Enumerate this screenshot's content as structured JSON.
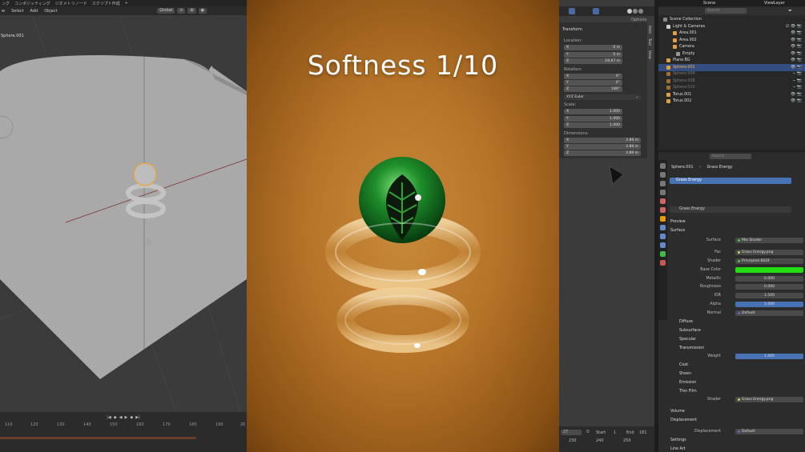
{
  "left_menu": [
    "ング",
    "コンポジッティング",
    "ジオメトリノード",
    "スクリプト作成",
    "+"
  ],
  "left_header": {
    "items": [
      "w",
      "Select",
      "Add",
      "Object"
    ],
    "transform": "Global"
  },
  "left_viewport": {
    "object_label": "Sphere.001"
  },
  "timeline_left": {
    "ticks": [
      "110",
      "120",
      "130",
      "140",
      "150",
      "160",
      "170",
      "180",
      "190",
      "20"
    ]
  },
  "render": {
    "title": "Softness 1/10"
  },
  "npanel": {
    "options": "Options",
    "transform": "Transform",
    "location": "Location:",
    "loc": [
      {
        "axis": "X",
        "value": "0 m"
      },
      {
        "axis": "Y",
        "value": "0 m"
      },
      {
        "axis": "Z",
        "value": "18.67 m"
      }
    ],
    "rotation": "Rotation:",
    "rot": [
      {
        "axis": "X",
        "value": "0°"
      },
      {
        "axis": "Y",
        "value": "0°"
      },
      {
        "axis": "Z",
        "value": "180°"
      }
    ],
    "euler": "XYZ Euler",
    "scale": "Scale:",
    "scl": [
      {
        "axis": "X",
        "value": "1.000"
      },
      {
        "axis": "Y",
        "value": "1.000"
      },
      {
        "axis": "Z",
        "value": "1.000"
      }
    ],
    "dimensions": "Dimensions:",
    "dim": [
      {
        "axis": "X",
        "value": "3.89 m"
      },
      {
        "axis": "Y",
        "value": "3.89 m"
      },
      {
        "axis": "Z",
        "value": "3.89 m"
      }
    ],
    "tabs": [
      "Item",
      "Tool",
      "View"
    ]
  },
  "timeline_right": {
    "frame": "27",
    "start_label": "Start",
    "start": "1",
    "end_label": "End",
    "end": "181",
    "ticks": [
      "230",
      "240",
      "250"
    ]
  },
  "outliner": {
    "scene": "Scene",
    "viewlayer": "ViewLayer",
    "search": "Search",
    "rows": [
      {
        "name": "Scene Collection",
        "color": "#cccccc"
      },
      {
        "name": "Light & Cameras",
        "color": "#cccccc"
      },
      {
        "name": "Area.001",
        "color": "#e0a040"
      },
      {
        "name": "Area.002",
        "color": "#e0a040"
      },
      {
        "name": "Camera",
        "color": "#e0a040"
      },
      {
        "name": "Empty",
        "color": "#e0a040"
      },
      {
        "name": "Plane.BG",
        "color": "#e0a040"
      },
      {
        "name": "Sphere.001",
        "color": "#e0a040"
      },
      {
        "name": "Sphere.009",
        "color": "#e0a040"
      },
      {
        "name": "Sphere.008",
        "color": "#e0a040"
      },
      {
        "name": "Sphere.010",
        "color": "#e0a040"
      },
      {
        "name": "Torus.001",
        "color": "#e0a040"
      },
      {
        "name": "Torus.002",
        "color": "#e0a040"
      }
    ]
  },
  "properties": {
    "search": "Search",
    "breadcrumb_obj": "Sphere.001",
    "breadcrumb_mat": "Grass Energy",
    "slot": "Grass Energy",
    "material": "Grass Energy",
    "preview": "Preview",
    "surface": "Surface",
    "rows": [
      {
        "label": "Surface",
        "value": "Mix Shader",
        "style": ""
      },
      {
        "label": "Fac",
        "value": "Grass Energy.png",
        "style": ""
      },
      {
        "label": "Shader",
        "value": "Principled BSDF",
        "style": ""
      },
      {
        "label": "Base Color",
        "value": "",
        "style": "green"
      },
      {
        "label": "Metallic",
        "value": "0.000",
        "style": "center"
      },
      {
        "label": "Roughness",
        "value": "0.000",
        "style": "center"
      },
      {
        "label": "IOR",
        "value": "1.500",
        "style": "center"
      },
      {
        "label": "Alpha",
        "value": "1.000",
        "style": "blue"
      },
      {
        "label": "Normal",
        "value": "Default",
        "style": ""
      }
    ],
    "subsections": [
      "Diffuse",
      "Subsurface",
      "Specular",
      "Transmission"
    ],
    "weight_label": "Weight",
    "weight": "1.000",
    "subsections2": [
      "Coat",
      "Sheen",
      "Emission",
      "Thin Film"
    ],
    "shader2_label": "Shader",
    "shader2": "Grass Energy.png",
    "volume": "Volume",
    "displacement": "Displacement",
    "disp_label": "Displacement",
    "disp_value": "Default",
    "settings": "Settings",
    "lineart": "Line Art"
  }
}
